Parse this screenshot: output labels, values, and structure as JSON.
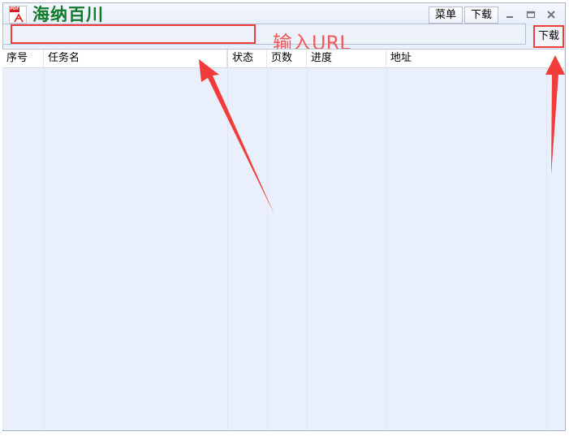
{
  "app": {
    "title": "海纳百川",
    "icon_tag": "PDF",
    "icon": "pdf-app-icon"
  },
  "titlebar": {
    "menu_label": "菜单",
    "download_label": "下载",
    "controls": [
      "minimize-icon",
      "maximize-icon",
      "close-icon"
    ]
  },
  "toolbar": {
    "url_value": "",
    "download_label": "下载"
  },
  "annotation": {
    "url_hint": "输入URL",
    "color": "#f03c3c"
  },
  "table": {
    "columns": [
      "序号",
      "任务名",
      "状态",
      "页数",
      "进度",
      "地址"
    ],
    "rows": []
  },
  "colors": {
    "title_green": "#117a2b",
    "window_bg": "#eaf0fb",
    "highlight_red": "#f03c3c"
  }
}
